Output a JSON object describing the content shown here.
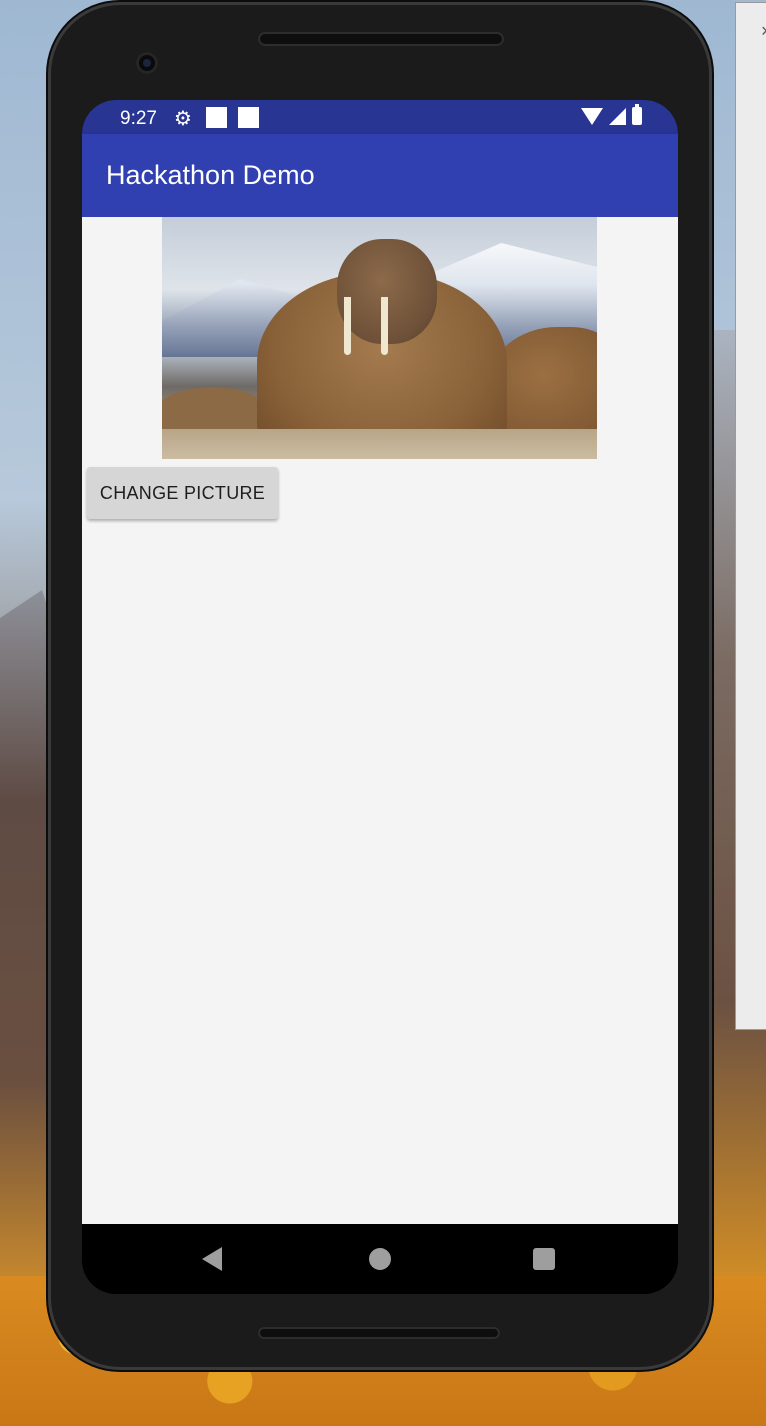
{
  "status_bar": {
    "time": "9:27",
    "icons": [
      "gear-icon",
      "notification-square-icon",
      "notification-square-icon",
      "wifi-icon",
      "signal-icon",
      "battery-charging-icon"
    ]
  },
  "app_bar": {
    "title": "Hackathon Demo"
  },
  "main": {
    "image_subject": "walrus-photo",
    "change_button_label": "CHANGE PICTURE"
  },
  "nav_bar": {
    "icons": [
      "back-icon",
      "home-icon",
      "recents-icon"
    ]
  },
  "desktop": {
    "side_window_close": "×"
  },
  "colors": {
    "status_bar": "#283593",
    "app_bar": "#3140b1",
    "content_bg": "#f4f4f4",
    "button_bg": "#d6d6d6"
  }
}
